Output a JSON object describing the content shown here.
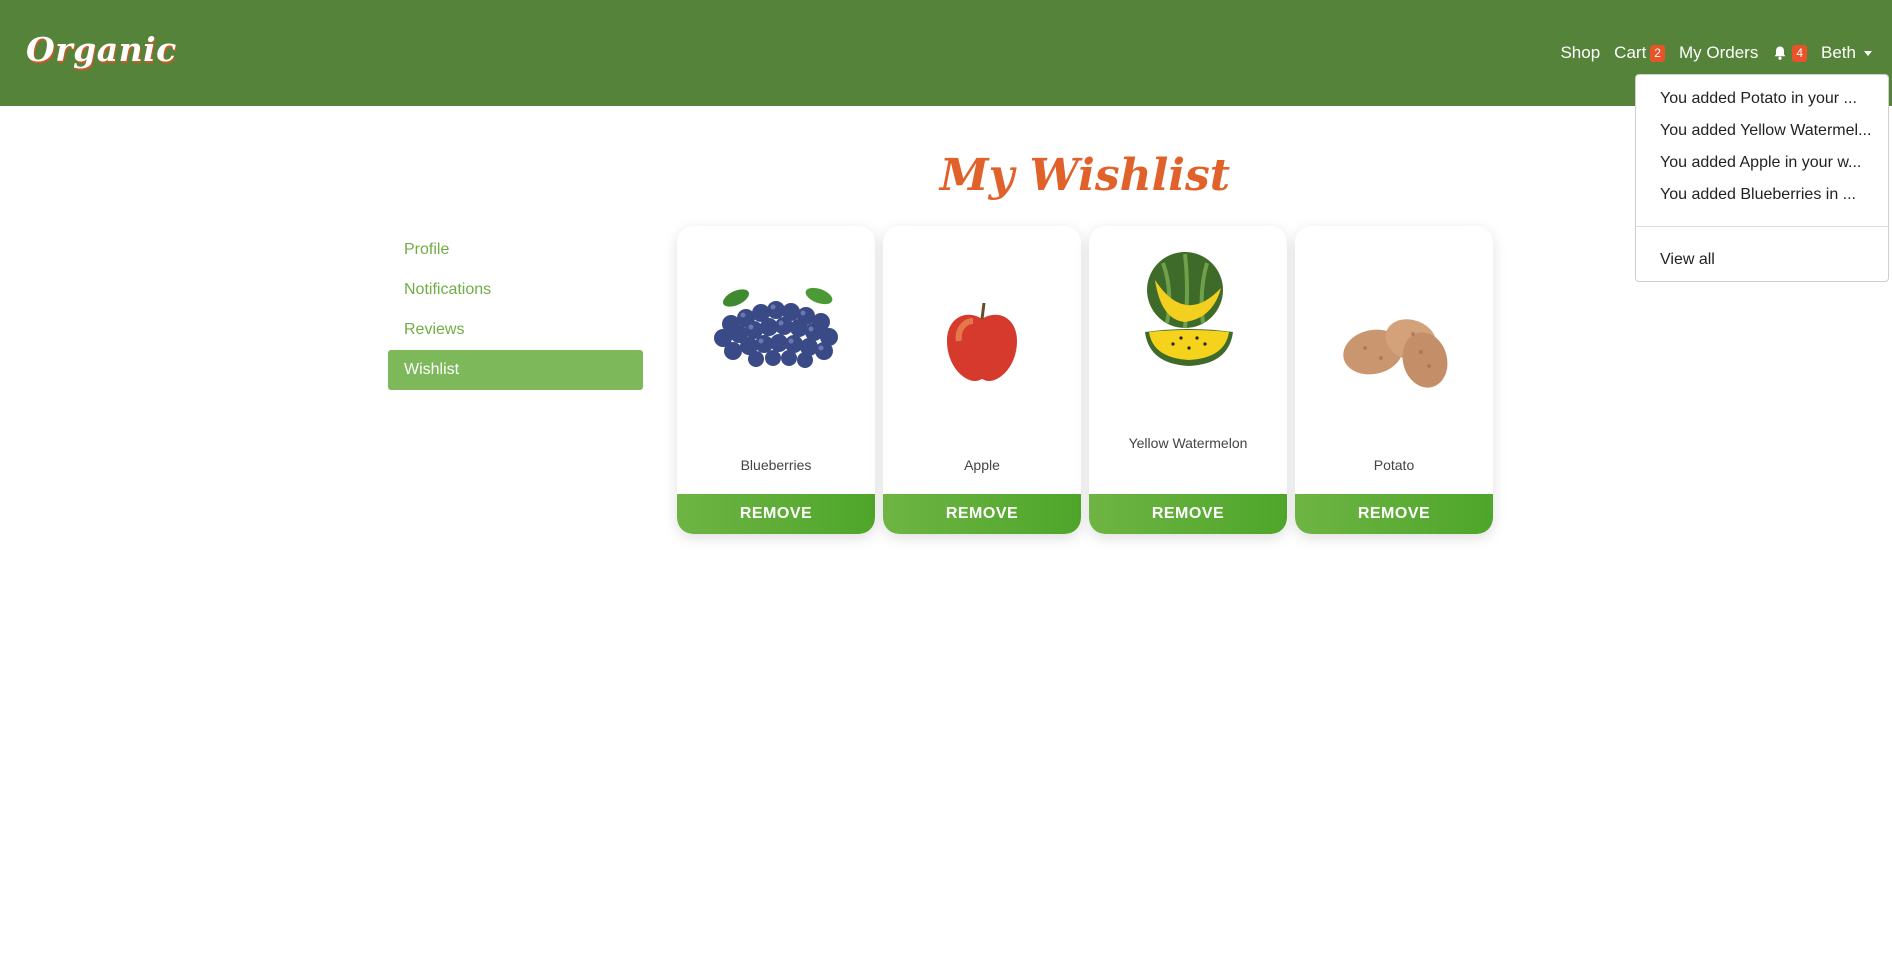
{
  "brand": "Organic",
  "nav": {
    "shop": "Shop",
    "cart": "Cart",
    "cart_count": "2",
    "orders": "My Orders",
    "notifications_count": "4",
    "user": "Beth"
  },
  "notifications": {
    "items": [
      "You added Potato in your ...",
      "You added Yellow Watermel...",
      "You added Apple in your w...",
      "You added Blueberries in ..."
    ],
    "view_all": "View all"
  },
  "title": "My Wishlist",
  "sidebar": {
    "items": [
      {
        "label": "Profile"
      },
      {
        "label": "Notifications"
      },
      {
        "label": "Reviews"
      },
      {
        "label": "Wishlist"
      }
    ]
  },
  "wishlist": [
    {
      "name": "Blueberries",
      "image": "blueberries-image",
      "action": "REMOVE"
    },
    {
      "name": "Apple",
      "image": "apple-image",
      "action": "REMOVE"
    },
    {
      "name": "Yellow Watermelon",
      "image": "yellow-watermelon-image",
      "action": "REMOVE"
    },
    {
      "name": "Potato",
      "image": "potato-image",
      "action": "REMOVE"
    }
  ],
  "colors": {
    "navbar": "#55833a",
    "accent": "#e0622a",
    "sidebar_active": "#7db85a",
    "button": "#5aac36",
    "badge": "#e8532a"
  }
}
